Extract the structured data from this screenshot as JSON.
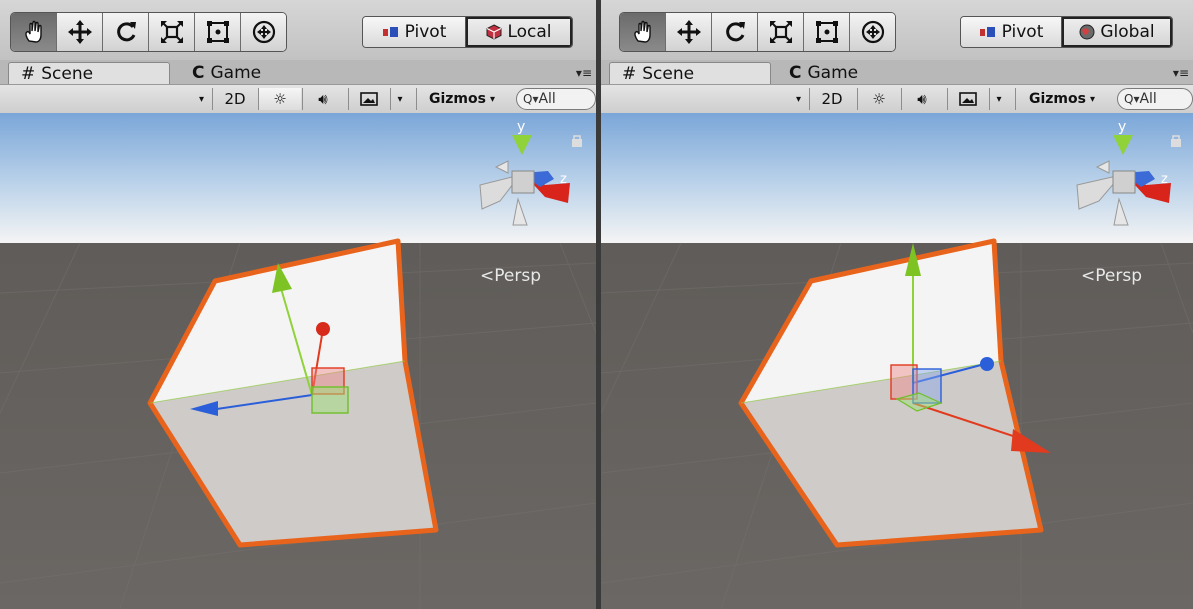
{
  "left_panel": {
    "toolbar": {
      "tools": [
        {
          "name": "hand-tool",
          "icon": "hand-icon",
          "active": true
        },
        {
          "name": "move-tool",
          "icon": "move-arrows-icon",
          "active": false
        },
        {
          "name": "rotate-tool",
          "icon": "rotate-icon",
          "active": false
        },
        {
          "name": "scale-tool",
          "icon": "scale-icon",
          "active": false
        },
        {
          "name": "rect-tool",
          "icon": "rect-transform-icon",
          "active": false
        },
        {
          "name": "transform-tool",
          "icon": "transform-icon",
          "active": false
        }
      ],
      "pivot_label": "Pivot",
      "space_label": "Local"
    },
    "tabs": {
      "scene": "Scene",
      "game": "Game"
    },
    "scenebar": {
      "mode_2d": "2D",
      "gizmos": "Gizmos",
      "search_placeholder": "All"
    },
    "viewport": {
      "projection": "Persp",
      "axis_y": "y",
      "axis_z": "z"
    }
  },
  "right_panel": {
    "toolbar": {
      "pivot_label": "Pivot",
      "space_label": "Global"
    },
    "tabs": {
      "scene": "Scene",
      "game": "Game"
    },
    "scenebar": {
      "mode_2d": "2D",
      "gizmos": "Gizmos",
      "search_placeholder": "All"
    },
    "viewport": {
      "projection": "Persp",
      "axis_y": "y",
      "axis_z": "z"
    }
  },
  "colors": {
    "x_axis": "#e23a1e",
    "y_axis": "#8fd23a",
    "z_axis": "#2b5fd9",
    "selection_outline": "#e8641c",
    "sky_top": "#7aa6d8",
    "ground": "#5e5a57"
  }
}
